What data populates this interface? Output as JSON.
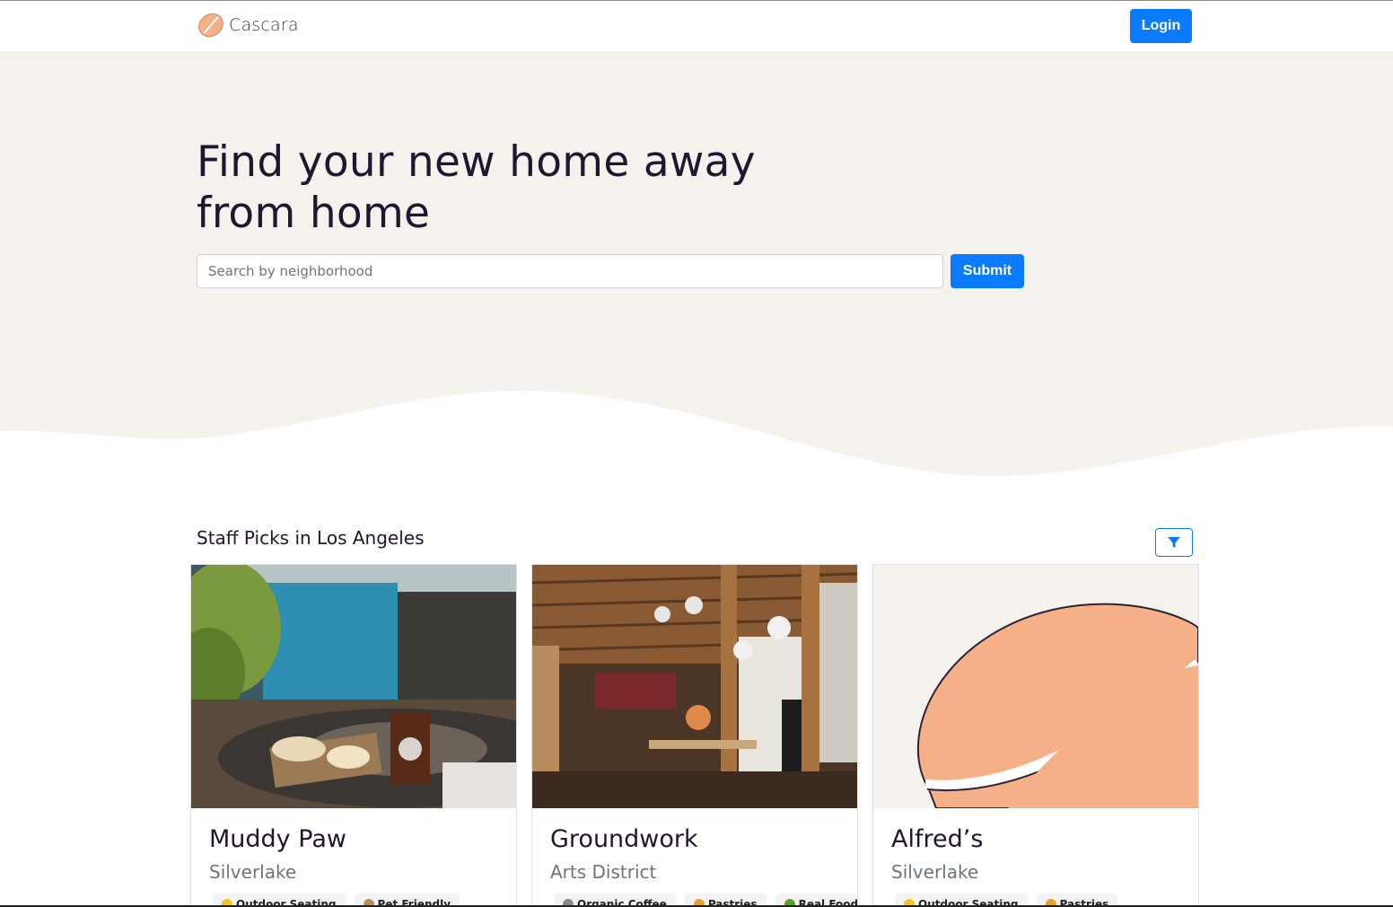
{
  "brand": {
    "name": "Cascara",
    "icon": "coffee-bean-icon"
  },
  "nav": {
    "login_label": "Login"
  },
  "hero": {
    "title": "Find your new home away from home",
    "search_placeholder": "Search by neighborhood",
    "submit_label": "Submit"
  },
  "section": {
    "title": "Staff Picks in Los Angeles",
    "filter_icon": "filter-icon"
  },
  "cards": [
    {
      "name": "Muddy Paw",
      "neighborhood": "Silverlake",
      "tags": [
        "Outdoor Seating",
        "Pet Friendly"
      ]
    },
    {
      "name": "Groundwork",
      "neighborhood": "Arts District",
      "tags": [
        "Organic Coffee",
        "Pastries",
        "Real Food"
      ]
    },
    {
      "name": "Alfred’s",
      "neighborhood": "Silverlake",
      "tags": [
        "Outdoor Seating",
        "Pastries"
      ]
    }
  ],
  "colors": {
    "accent": "#0a7bff",
    "hero_bg": "#f5f2ee",
    "bean": "#f6b088",
    "heading": "#221530"
  }
}
